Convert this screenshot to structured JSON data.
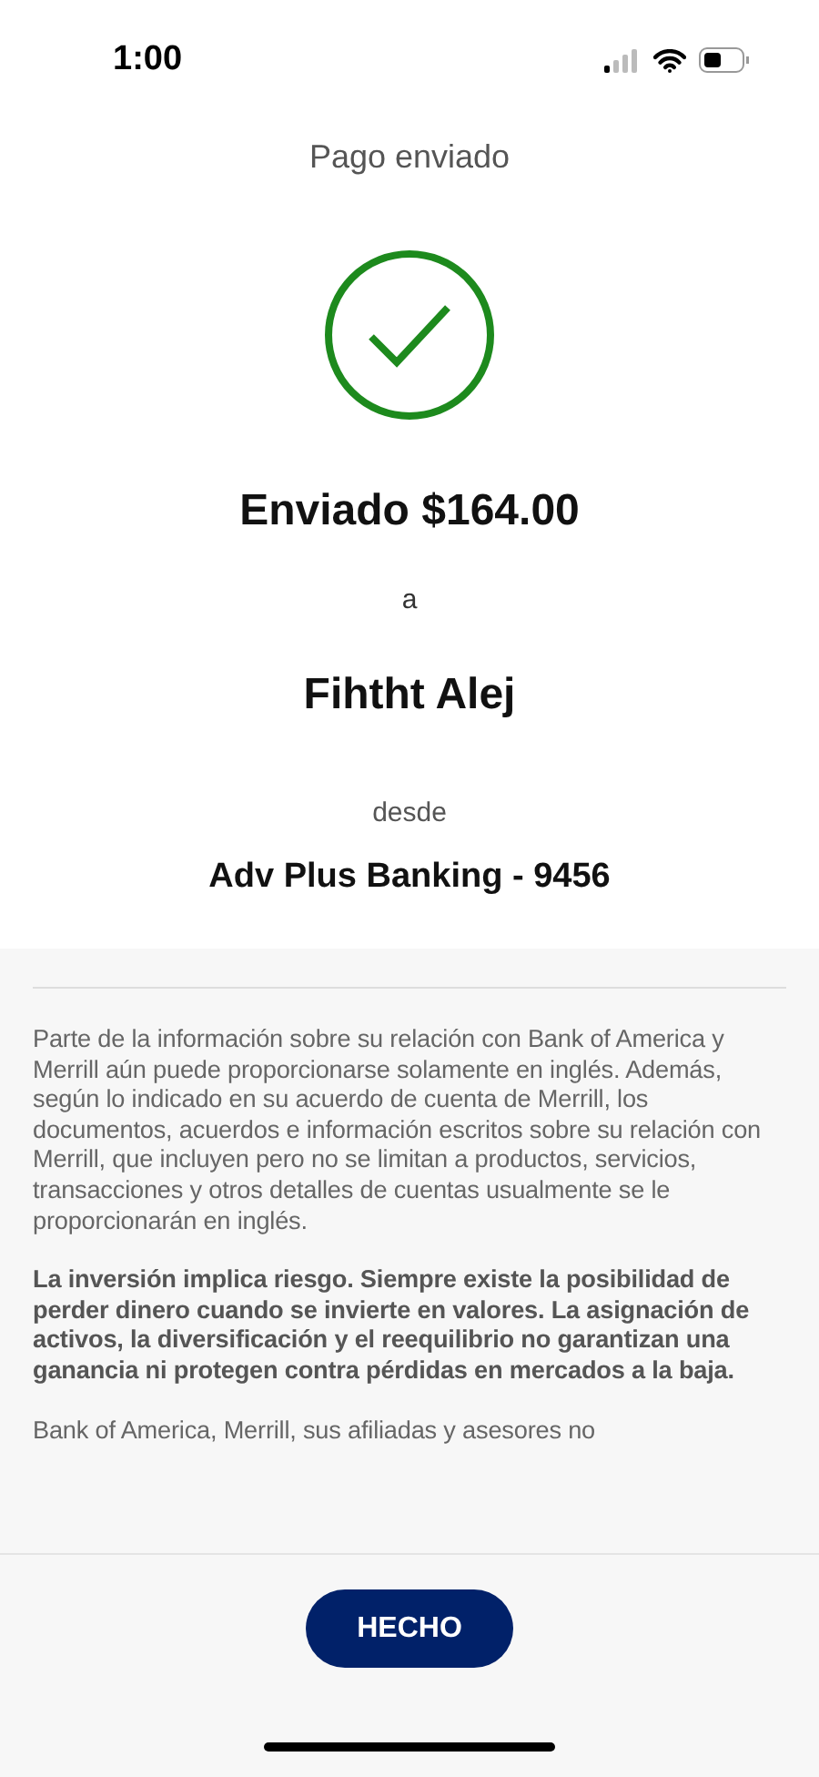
{
  "status_bar": {
    "time": "1:00"
  },
  "header": {
    "title": "Pago enviado"
  },
  "confirmation": {
    "amount": "Enviado $164.00",
    "to_label": "a",
    "recipient": "Fihtht Alej",
    "from_label": "desde",
    "account": "Adv Plus Banking - 9456"
  },
  "disclosures": [
    {
      "text": "Parte de la información sobre su relación con Bank of America y Merrill aún puede proporcionarse solamente en inglés. Además, según lo indicado en su acuerdo de cuenta de Merrill, los documentos, acuerdos e información escritos sobre su relación con Merrill, que incluyen pero no se limitan a productos, servicios, transacciones y otros detalles de cuentas usualmente se le proporcionarán en inglés.",
      "bold": false
    },
    {
      "text": "La inversión implica riesgo. Siempre existe la posibilidad de perder dinero cuando se invierte en valores. La asignación de activos, la diversificación y el reequilibrio no garantizan una ganancia ni protegen contra pérdidas en mercados a la baja.",
      "bold": true
    },
    {
      "text": "Bank of America, Merrill, sus afiliadas y asesores no",
      "bold": false
    }
  ],
  "footer": {
    "button": "HECHO"
  }
}
